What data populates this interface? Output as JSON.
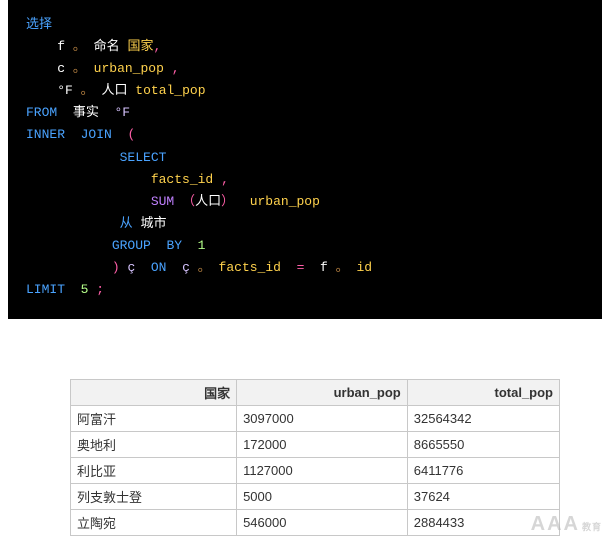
{
  "code": {
    "l1": {
      "kw": "选择"
    },
    "l2": {
      "id": "f",
      "dot": "。",
      "name": "命名",
      "col": "国家",
      "comma": ","
    },
    "l3": {
      "id": "c",
      "dot": "。",
      "col": "urban_pop",
      "comma": ","
    },
    "l4": {
      "id": "°F",
      "dot": "。",
      "name": "人口",
      "col": "total_pop"
    },
    "l5": {
      "kw": "FROM",
      "name": "事实",
      "alias": "°F"
    },
    "l6": {
      "kw1": "INNER",
      "kw2": "JOIN",
      "paren": "("
    },
    "l7": {
      "kw": "SELECT"
    },
    "l8": {
      "col": "facts_id",
      "comma": ","
    },
    "l9": {
      "fn": "SUM",
      "p1": "（",
      "arg": "人口",
      "p2": "）",
      "col": "urban_pop"
    },
    "l10": {
      "kw": "从",
      "name": "城市"
    },
    "l11": {
      "kw1": "GROUP",
      "kw2": "BY",
      "num": "1"
    },
    "l12": {
      "paren": ")",
      "alias1": "ç",
      "on": "ON",
      "alias2": "ç",
      "dot1": "。",
      "col1": "facts_id",
      "eq": "=",
      "id2": "f",
      "dot2": "。",
      "col2": "id"
    },
    "l13": {
      "kw": "LIMIT",
      "num": "5",
      "semi": ";"
    }
  },
  "table": {
    "headers": {
      "c1": "国家",
      "c2": "urban_pop",
      "c3": "total_pop"
    },
    "rows": [
      {
        "c1": "阿富汗",
        "c2": "3097000",
        "c3": "32564342"
      },
      {
        "c1": "奥地利",
        "c2": "172000",
        "c3": "8665550"
      },
      {
        "c1": "利比亚",
        "c2": "1127000",
        "c3": "6411776"
      },
      {
        "c1": "列支敦士登",
        "c2": "5000",
        "c3": "37624"
      },
      {
        "c1": "立陶宛",
        "c2": "546000",
        "c3": "2884433"
      }
    ]
  },
  "watermark": {
    "main": "AAA",
    "sub": "教育"
  }
}
